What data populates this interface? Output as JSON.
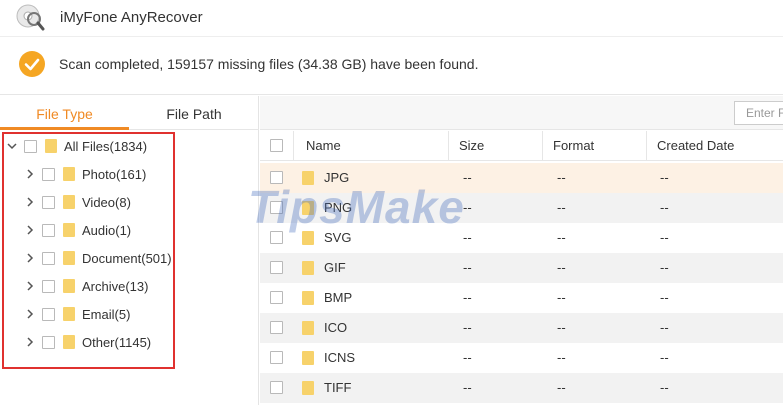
{
  "app": {
    "title": "iMyFone AnyRecover",
    "logo_icon": "disc-magnifier-icon"
  },
  "status": {
    "icon": "checkmark-icon",
    "text": "Scan completed, 159157 missing files (34.38 GB) have been found."
  },
  "left": {
    "tabs": [
      {
        "label": "File Type",
        "active": true
      },
      {
        "label": "File Path",
        "active": false
      }
    ],
    "tree": [
      {
        "label": "All Files(1834)",
        "level": 0,
        "expanded": true
      },
      {
        "label": "Photo(161)",
        "level": 1,
        "selected": true
      },
      {
        "label": "Video(8)",
        "level": 1
      },
      {
        "label": "Audio(1)",
        "level": 1
      },
      {
        "label": "Document(501)",
        "level": 1
      },
      {
        "label": "Archive(13)",
        "level": 1
      },
      {
        "label": "Email(5)",
        "level": 1
      },
      {
        "label": "Other(1145)",
        "level": 1
      }
    ]
  },
  "right": {
    "search_placeholder": "Enter F",
    "columns": [
      "Name",
      "Size",
      "Format",
      "Created Date"
    ],
    "rows": [
      {
        "name": "JPG",
        "size": "--",
        "format": "--",
        "created": "--"
      },
      {
        "name": "PNG",
        "size": "--",
        "format": "--",
        "created": "--"
      },
      {
        "name": "SVG",
        "size": "--",
        "format": "--",
        "created": "--"
      },
      {
        "name": "GIF",
        "size": "--",
        "format": "--",
        "created": "--"
      },
      {
        "name": "BMP",
        "size": "--",
        "format": "--",
        "created": "--"
      },
      {
        "name": "ICO",
        "size": "--",
        "format": "--",
        "created": "--"
      },
      {
        "name": "ICNS",
        "size": "--",
        "format": "--",
        "created": "--"
      },
      {
        "name": "TIFF",
        "size": "--",
        "format": "--",
        "created": "--"
      }
    ]
  },
  "watermark": "TipsMake",
  "colors": {
    "accent": "#f08a24",
    "highlight_border": "#e0312f",
    "folder": "#f7d26b",
    "selected_row": "#fdf1e4"
  }
}
